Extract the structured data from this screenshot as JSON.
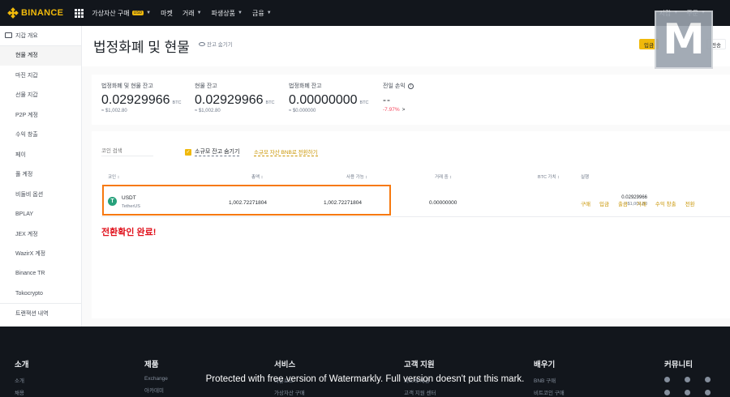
{
  "topbar": {
    "brand": "BINANCE",
    "nav": [
      {
        "label": "가상자산 구매",
        "badge": "USD",
        "caret": true
      },
      {
        "label": "마켓",
        "caret": false
      },
      {
        "label": "거래",
        "caret": true
      },
      {
        "label": "파생상품",
        "caret": true
      },
      {
        "label": "금융",
        "caret": true
      }
    ],
    "right": [
      {
        "label": "지갑",
        "caret": true
      },
      {
        "label": "주문",
        "caret": true
      }
    ]
  },
  "sidebar": {
    "items": [
      {
        "label": "지갑 개요"
      },
      {
        "label": "현물 계정"
      },
      {
        "label": "마진 지갑"
      },
      {
        "label": "선물 지갑"
      },
      {
        "label": "P2P 계정"
      },
      {
        "label": "수익 창출"
      },
      {
        "label": "페이"
      },
      {
        "label": "풀 계정"
      },
      {
        "label": "비둘비 옵션"
      },
      {
        "label": "BPLAY"
      },
      {
        "label": "JEX 계정"
      },
      {
        "label": "WazirX 계정"
      },
      {
        "label": "Binance TR"
      },
      {
        "label": "Tokocrypto"
      },
      {
        "label": "트랜잭션 내역"
      }
    ]
  },
  "page": {
    "title": "법정화폐 및 현물",
    "hide_balance": "잔고 숨기기",
    "deposit": "입금",
    "transfer": "전송"
  },
  "summary": {
    "total": {
      "label": "법정화폐 및 현물 잔고",
      "value": "0.02929966",
      "unit": "BTC",
      "usd": "≈ $1,002.80"
    },
    "spot": {
      "label": "현물 잔고",
      "value": "0.02929966",
      "unit": "BTC",
      "usd": "≈ $1,002.80"
    },
    "fiat": {
      "label": "법정화폐 잔고",
      "value": "0.00000000",
      "unit": "BTC",
      "usd": "≈ $0.000000"
    },
    "pnl": {
      "label": "전일 손익",
      "info": "i",
      "value": "--",
      "pct": "-7.97%",
      "arrow": ">"
    }
  },
  "table": {
    "search_placeholder": "코인 검색",
    "small_balance": "소규모 잔고 숨기기",
    "convert_link": "소규모 자산 BNB로 전환하기",
    "headers": {
      "coin": "코인 ↕",
      "total": "총액 ↕",
      "available": "사용 가능 ↕",
      "in_order": "거래 중 ↕",
      "btc_value": "BTC 가치 ↕",
      "action": "실행"
    },
    "rows": [
      {
        "icon_letter": "T",
        "symbol": "USDT",
        "name": "TetherUS",
        "total": "1,002.72271804",
        "available": "1,002.72271804",
        "in_order": "0.00000000",
        "btc_value": "0.02929966",
        "usd_value": "≈ $1,002.80",
        "actions": [
          "구매",
          "입금",
          "출금",
          "거래",
          "수익 창출",
          "전환"
        ]
      }
    ]
  },
  "annotation": {
    "text": "전환확인 완료!",
    "highlight_color": "#f7790f",
    "text_color": "#e0101b"
  },
  "footer": {
    "columns": [
      {
        "title": "소개",
        "links": [
          "소개",
          "채용"
        ]
      },
      {
        "title": "제품",
        "links": [
          "Exchange",
          "아카데미"
        ]
      },
      {
        "title": "서비스",
        "links": [
          "다운로드",
          "가상자산 구매"
        ]
      },
      {
        "title": "고객 지원",
        "links": [
          "피드백 제공",
          "고객 지원 센터"
        ]
      },
      {
        "title": "배우기",
        "links": [
          "BNB 구매",
          "비트코인 구매"
        ]
      },
      {
        "title": "커뮤니티",
        "links": []
      }
    ],
    "watermark": "Protected with free version of Watermarkly. Full version doesn't put this mark."
  },
  "colors": {
    "brand": "#f0b90b",
    "topbar": "#12161c",
    "accent_link": "#c99400",
    "negative": "#f6465d",
    "tether": "#26a17b"
  }
}
